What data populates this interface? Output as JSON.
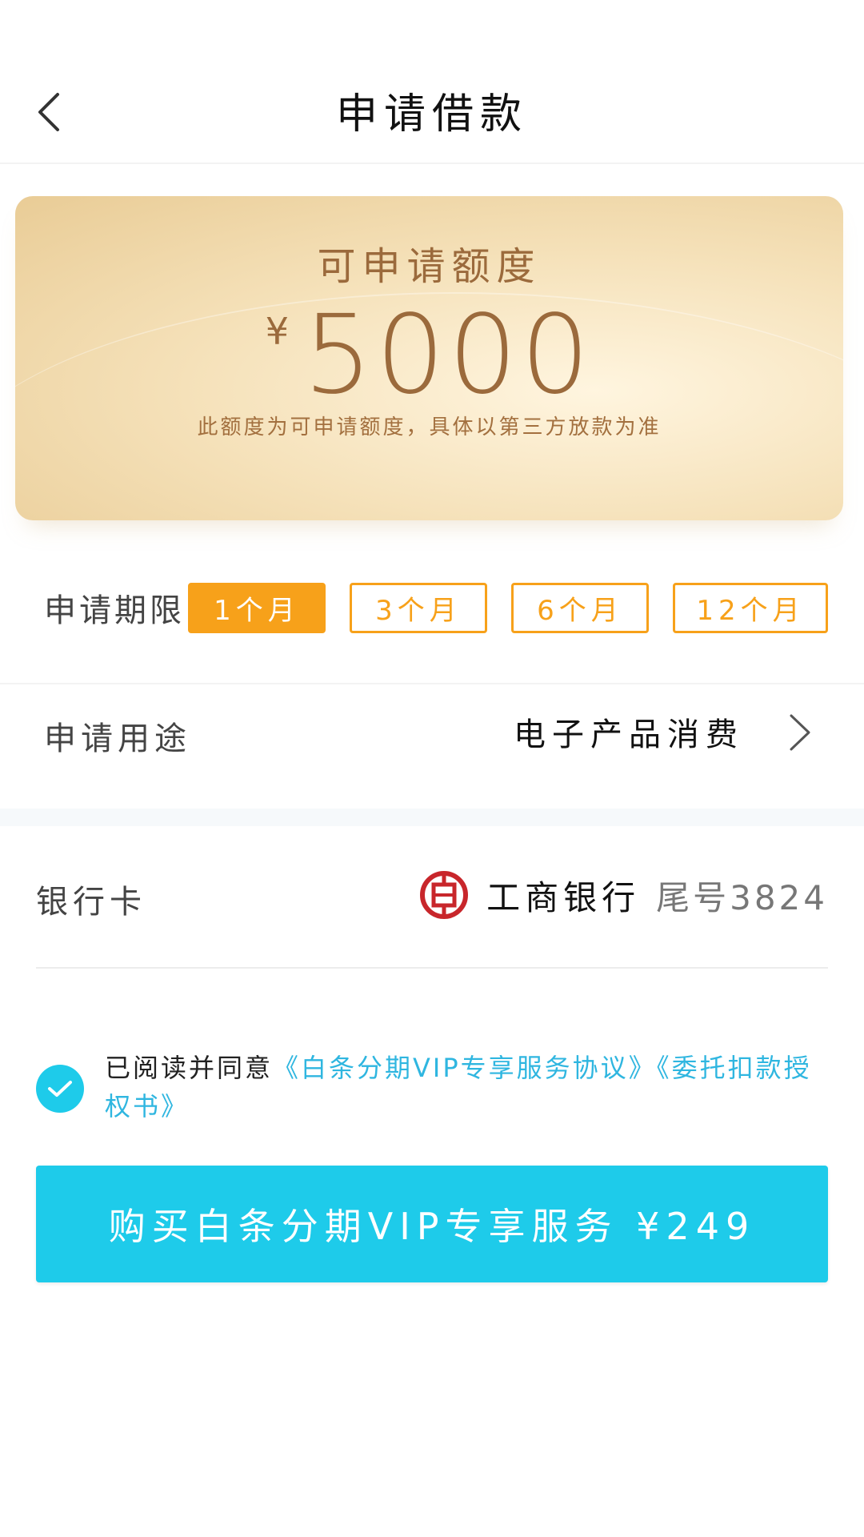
{
  "header": {
    "title": "申请借款"
  },
  "quota": {
    "label": "可申请额度",
    "currency": "¥",
    "amount": "5000",
    "note": "此额度为可申请额度，具体以第三方放款为准"
  },
  "term": {
    "label": "申请期限",
    "options": [
      {
        "label": "1个月",
        "selected": true
      },
      {
        "label": "3个月",
        "selected": false
      },
      {
        "label": "6个月",
        "selected": false
      },
      {
        "label": "12个月",
        "selected": false
      }
    ]
  },
  "purpose": {
    "label": "申请用途",
    "value": "电子产品消费"
  },
  "bank": {
    "label": "银行卡",
    "name": "工商银行",
    "tail": "尾号3824"
  },
  "agreement": {
    "prefix": "已阅读并同意",
    "link1": "《白条分期VIP专享服务协议》",
    "link2": "《委托扣款授权书》",
    "checked": true
  },
  "buy_button": {
    "label": "购买白条分期VIP专享服务 ¥249"
  },
  "colors": {
    "accent_cyan": "#1ecbea",
    "accent_orange": "#f7a11a",
    "gold_text": "#9b6a3c",
    "bank_red": "#c8262b"
  }
}
